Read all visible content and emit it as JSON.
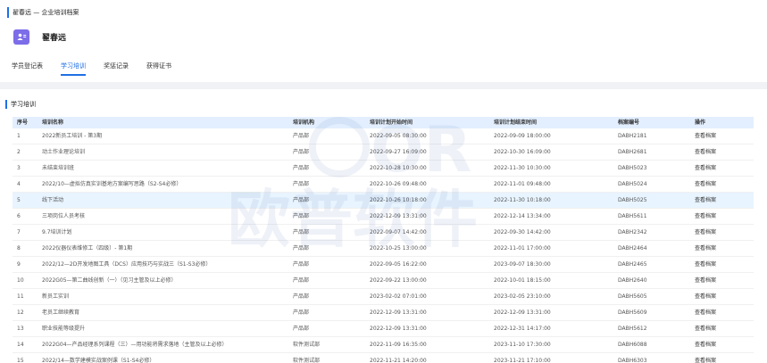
{
  "header": {
    "title": "翟春远 — 企业培训档案",
    "user_name": "翟春远"
  },
  "tabs": [
    {
      "label": "学员登记表"
    },
    {
      "label": "学习培训",
      "active": true
    },
    {
      "label": "奖惩记录"
    },
    {
      "label": "获得证书"
    }
  ],
  "section": {
    "title": "学习培训"
  },
  "table": {
    "columns": [
      "序号",
      "培训名称",
      "培训机构",
      "培训计划开始时间",
      "培训计划结束时间",
      "档案编号",
      "操作"
    ],
    "rows": [
      [
        "1",
        "2022新员工培训 - 第3期",
        "产品部",
        "2022-09-05 08:30:00",
        "2022-09-09 18:00:00",
        "DABH2181",
        "查看档案"
      ],
      [
        "2",
        "动土作业理论培训",
        "产品部",
        "2022-09-27 16:09:00",
        "2022-10-30 16:09:00",
        "DABH2681",
        "查看档案"
      ],
      [
        "3",
        "未结束培训班",
        "产品部",
        "2022-10-28 10:30:00",
        "2022-11-30 10:30:00",
        "DABH5023",
        "查看档案"
      ],
      [
        "4",
        "2022/10—虚拟仿真实训基地方案编写思路（S2-S4必修）",
        "产品部",
        "2022-10-26 09:48:00",
        "2022-11-01 09:48:00",
        "DABH5024",
        "查看档案"
      ],
      [
        "5",
        "线下活动",
        "产品部",
        "2022-10-26 10:18:00",
        "2022-11-30 10:18:00",
        "DABH5025",
        "查看档案"
      ],
      [
        "6",
        "三项岗位人员考核",
        "产品部",
        "2022-12-09 13:31:00",
        "2022-12-14 13:34:00",
        "DABH5611",
        "查看档案"
      ],
      [
        "7",
        "9.7培训计划",
        "产品部",
        "2022-09-07 14:42:00",
        "2022-09-30 14:42:00",
        "DABH2342",
        "查看档案"
      ],
      [
        "8",
        "2022仪器仪表维修工（四级）- 第1期",
        "产品部",
        "2022-10-25 13:00:00",
        "2022-11-01 17:00:00",
        "DABH2464",
        "查看档案"
      ],
      [
        "9",
        "2022/12—2D开发地图工具（DCS）应用技巧与实战三（S1-S3必修）",
        "产品部",
        "2022-09-05 16:22:00",
        "2023-09-07 18:30:00",
        "DABH2465",
        "查看档案"
      ],
      [
        "10",
        "2022G05—第二曲线创新（一）（见习主管及以上必修）",
        "产品部",
        "2022-09-22 13:00:00",
        "2022-10-01 18:15:00",
        "DABH2640",
        "查看档案"
      ],
      [
        "11",
        "新员工实训",
        "产品部",
        "2023-02-02 07:01:00",
        "2023-02-05 23:10:00",
        "DABH5605",
        "查看档案"
      ],
      [
        "12",
        "老员工继续教育",
        "产品部",
        "2022-12-09 13:31:00",
        "2022-12-09 13:31:00",
        "DABH5609",
        "查看档案"
      ],
      [
        "13",
        "职业技能等级提升",
        "产品部",
        "2022-12-09 13:31:00",
        "2022-12-31 14:17:00",
        "DABH5612",
        "查看档案"
      ],
      [
        "14",
        "2022G04—产品经理系列课程（三）—用功能将需求落地（主管及以上必修）",
        "软件测试部",
        "2022-11-09 16:35:00",
        "2023-11-10 17:30:00",
        "DABH6088",
        "查看档案"
      ],
      [
        "15",
        "2022/14—数学建模实战案例课（S1-S4必修）",
        "软件测试部",
        "2022-11-21 14:20:00",
        "2023-11-21 17:10:00",
        "DABH6303",
        "查看档案"
      ]
    ],
    "highlighted_row": 5
  },
  "watermark": {
    "text": "欧普软件",
    "letters": "OR"
  },
  "colors": {
    "accent": "#1f6fe5",
    "header_bg": "#e3efff",
    "avatar": "#7c6de8"
  }
}
